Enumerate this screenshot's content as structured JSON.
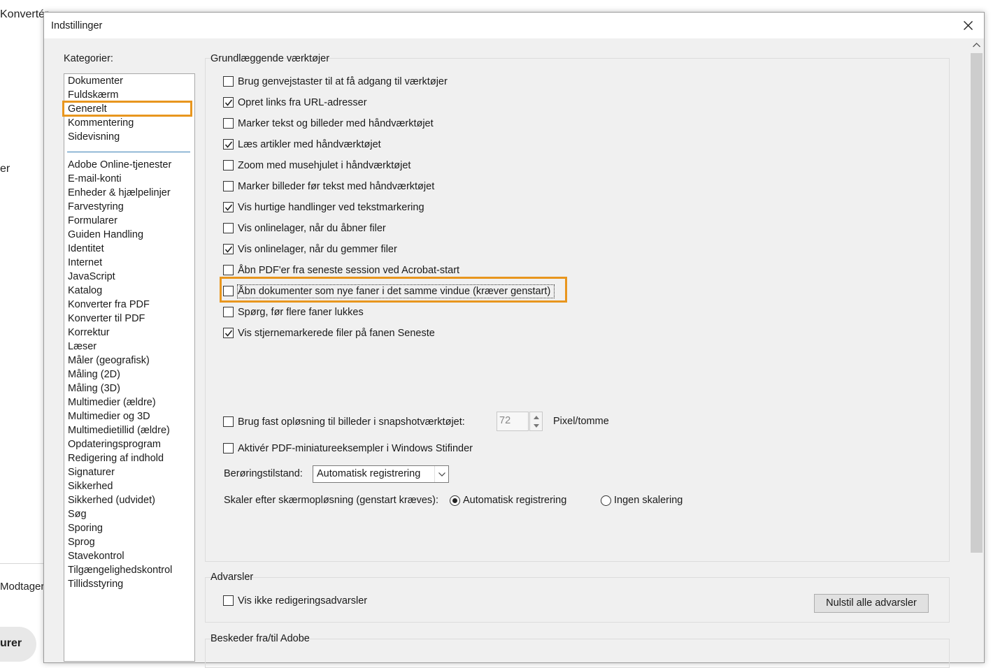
{
  "background": {
    "top_left_text": "Konvertér",
    "mid_left_text": "er",
    "lower_left_text": "Modtagere",
    "bottom_left_text": "urer"
  },
  "dialog": {
    "title": "Indstillinger",
    "categories_label": "Kategorier:",
    "categories_top": [
      "Dokumenter",
      "Fuldskærm",
      "Generelt",
      "Kommentering",
      "Sidevisning"
    ],
    "categories": [
      "Adobe Online-tjenester",
      "E-mail-konti",
      "Enheder & hjælpelinjer",
      "Farvestyring",
      "Formularer",
      "Guiden Handling",
      "Identitet",
      "Internet",
      "JavaScript",
      "Katalog",
      "Konverter fra PDF",
      "Konverter til PDF",
      "Korrektur",
      "Læser",
      "Måler (geografisk)",
      "Måling (2D)",
      "Måling (3D)",
      "Multimedier (ældre)",
      "Multimedier og 3D",
      "Multimedietillid (ældre)",
      "Opdateringsprogram",
      "Redigering af indhold",
      "Signaturer",
      "Sikkerhed",
      "Sikkerhed (udvidet)",
      "Søg",
      "Sporing",
      "Sprog",
      "Stavekontrol",
      "Tilgængelighedskontrol",
      "Tillidsstyring"
    ],
    "selected_category": "Generelt"
  },
  "basic_tools": {
    "title": "Grundlæggende værktøjer",
    "options": [
      {
        "label": "Brug genvejstaster til at få adgang til værktøjer",
        "checked": false
      },
      {
        "label": "Opret links fra URL-adresser",
        "checked": true
      },
      {
        "label": "Marker tekst og billeder med håndværktøjet",
        "checked": false
      },
      {
        "label": "Læs artikler med håndværktøjet",
        "checked": true
      },
      {
        "label": "Zoom med musehjulet i håndværktøjet",
        "checked": false
      },
      {
        "label": "Marker billeder før tekst med håndværktøjet",
        "checked": false
      },
      {
        "label": "Vis hurtige handlinger ved tekstmarkering",
        "checked": true
      },
      {
        "label": "Vis onlinelager, når du åbner filer",
        "checked": false
      },
      {
        "label": "Vis onlinelager, når du gemmer filer",
        "checked": true
      },
      {
        "label": "Åbn PDF'er fra seneste session ved Acrobat-start",
        "checked": false
      },
      {
        "label": "Åbn dokumenter som nye faner i det samme vindue (kræver genstart)",
        "checked": false
      },
      {
        "label": "Spørg, før flere faner lukkes",
        "checked": false
      },
      {
        "label": "Vis stjernemarkerede filer på fanen Seneste",
        "checked": true
      }
    ],
    "snapshot": {
      "label": "Brug fast opløsning til billeder i snapshotværktøjet:",
      "checked": false,
      "value": "72",
      "unit": "Pixel/tomme"
    },
    "thumbnails": {
      "label": "Aktivér PDF-miniatureeksempler i Windows Stifinder",
      "checked": false
    },
    "touch_mode": {
      "label": "Berøringstilstand:",
      "value": "Automatisk registrering"
    },
    "scaling": {
      "label": "Skaler efter skærmopløsning (genstart kræves):",
      "option_auto": "Automatisk registrering",
      "option_none": "Ingen skalering",
      "selected": "Automatisk registrering"
    }
  },
  "warnings": {
    "title": "Advarsler",
    "checkbox_label": "Vis ikke redigeringsadvarsler",
    "checked": false,
    "reset_button": "Nulstil alle advarsler"
  },
  "messages": {
    "title": "Beskeder fra/til Adobe"
  }
}
